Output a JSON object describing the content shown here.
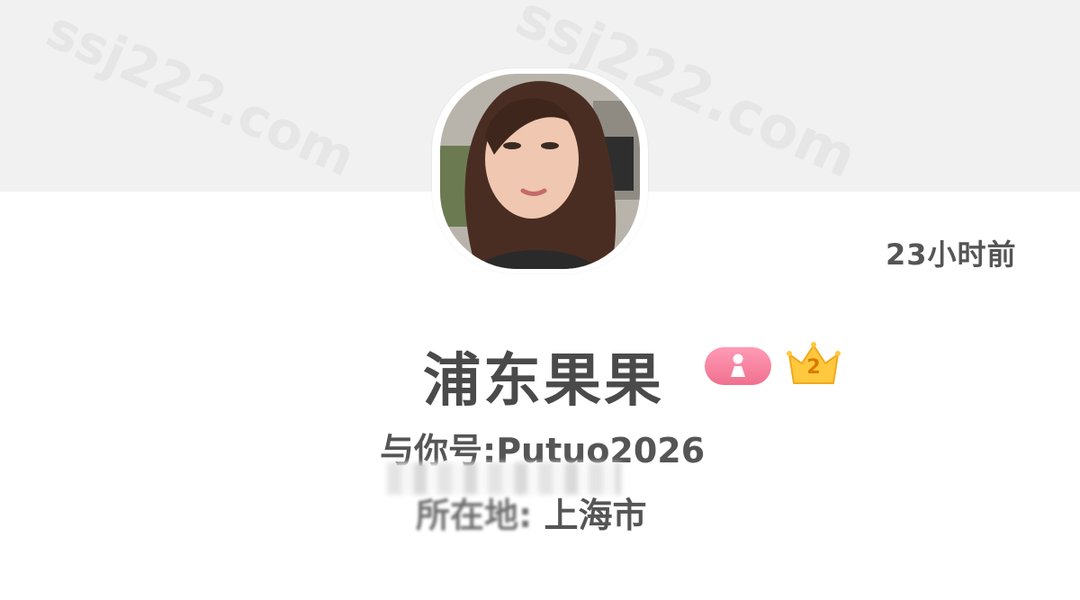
{
  "profile": {
    "nickname": "浦东果果",
    "id_line": "与你号:Putuo2026",
    "location_label": "所在地:",
    "location_value": "上海市",
    "last_active": "23小时前",
    "level": "2",
    "gender_icon": "female-user-icon",
    "level_icon": "crown-icon"
  },
  "watermark": {
    "text_1": "ssj222.com",
    "text_2": "ssj222.com"
  },
  "colors": {
    "top_band": "#f1f1f1",
    "gender_badge": "#f0708f",
    "crown": "#ffc83d",
    "text": "#4a4a4a"
  }
}
